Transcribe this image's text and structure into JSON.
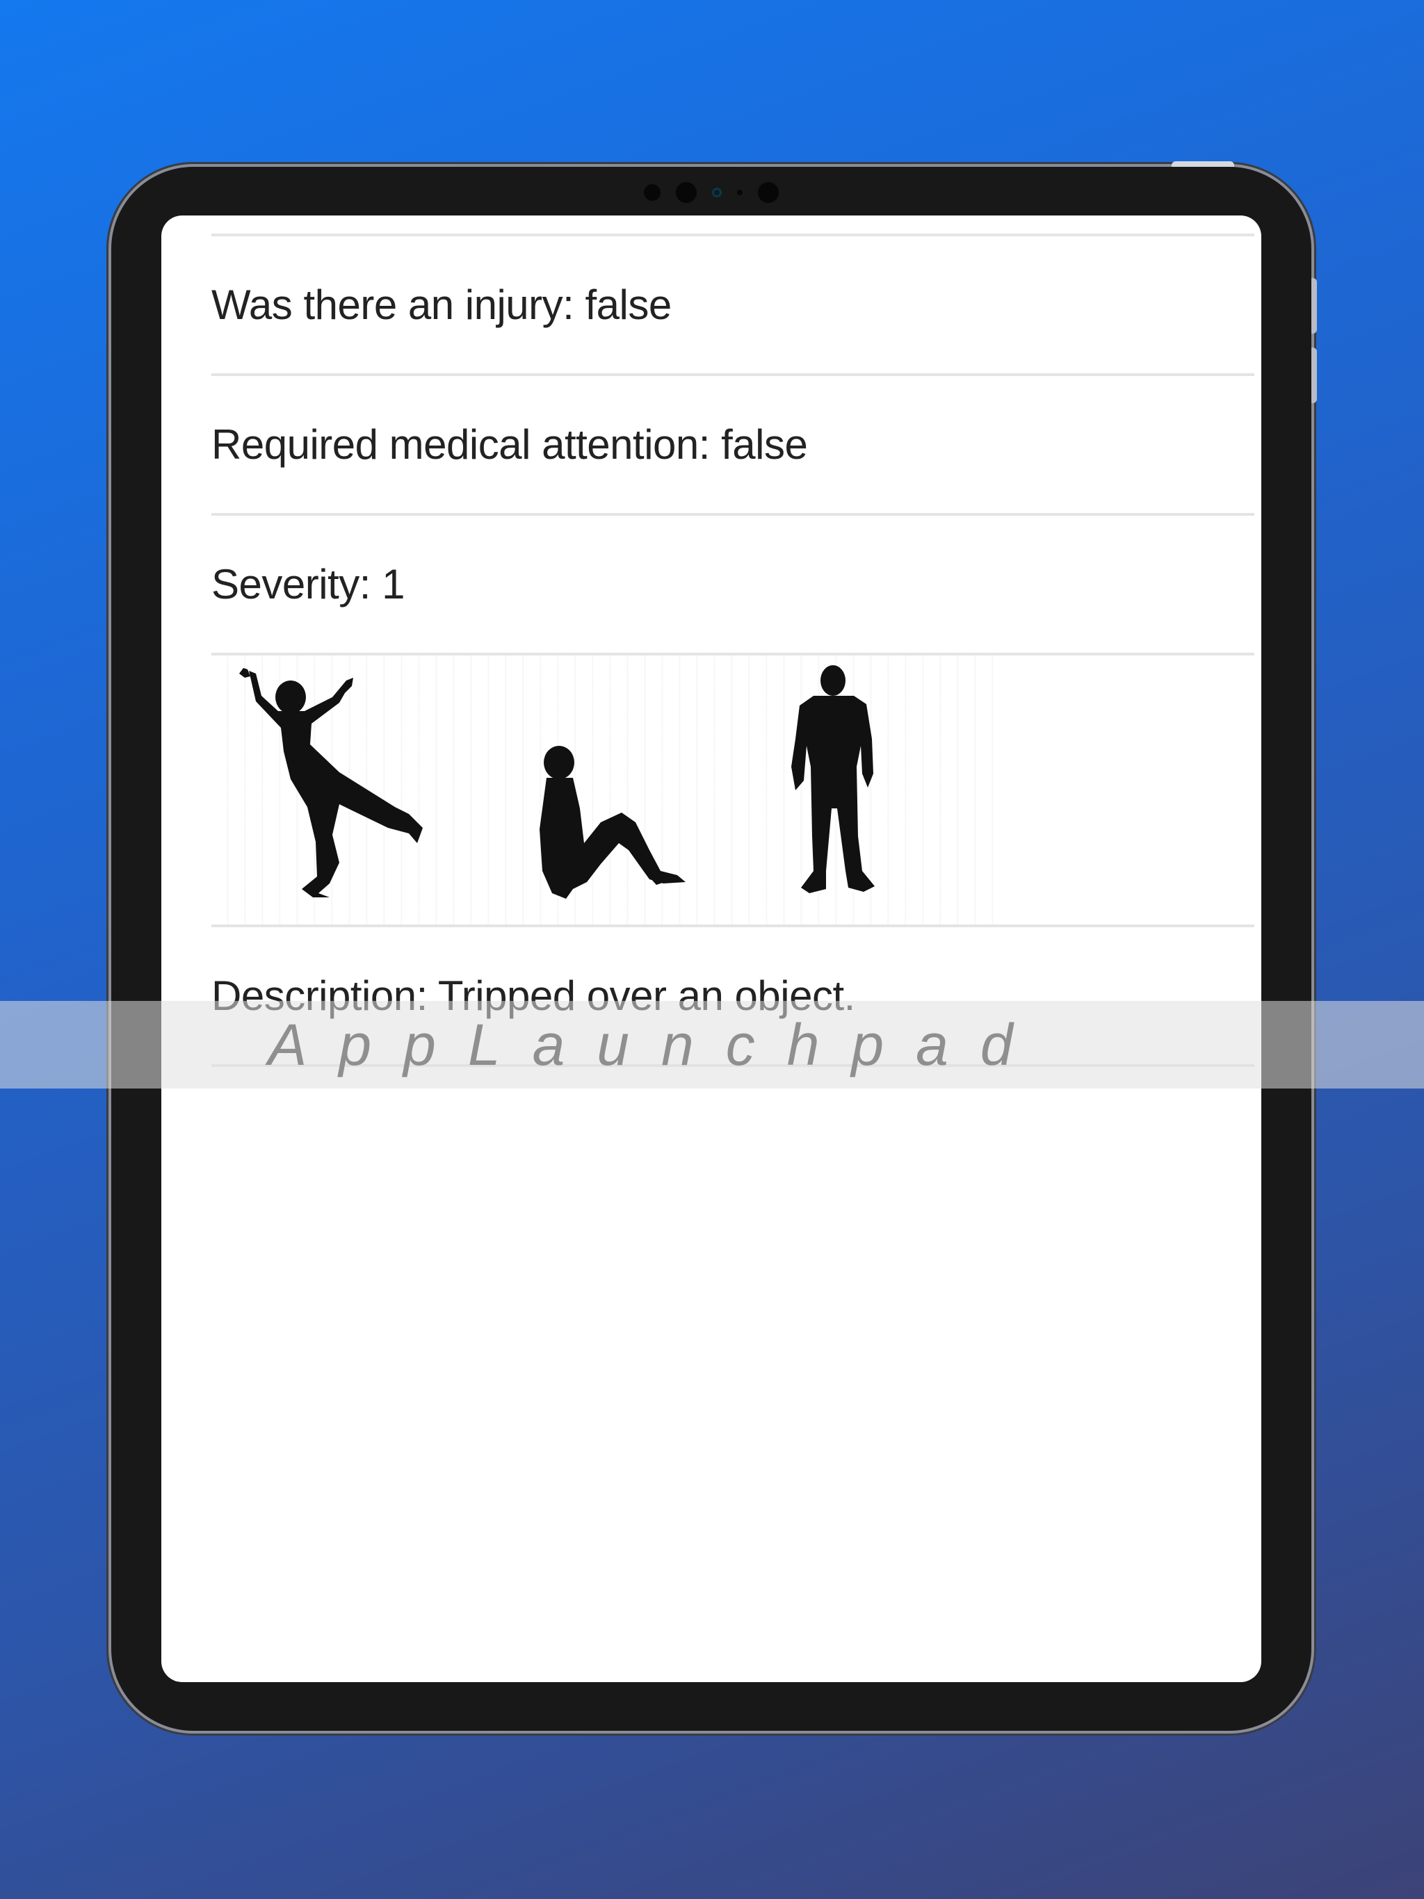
{
  "incident": {
    "injury": "Was there an injury: false",
    "medical": "Required medical attention: false",
    "severity": "Severity: 1",
    "description": "Description: Tripped over an object."
  },
  "illustration": {
    "figures": [
      "falling-person-icon",
      "sitting-person-icon",
      "standing-person-icon"
    ]
  },
  "watermark": {
    "text": "AppLaunchpad"
  },
  "colors": {
    "background_start": "#1478ee",
    "background_end": "#3c4377",
    "device_frame": "#181818",
    "text": "#222222"
  }
}
